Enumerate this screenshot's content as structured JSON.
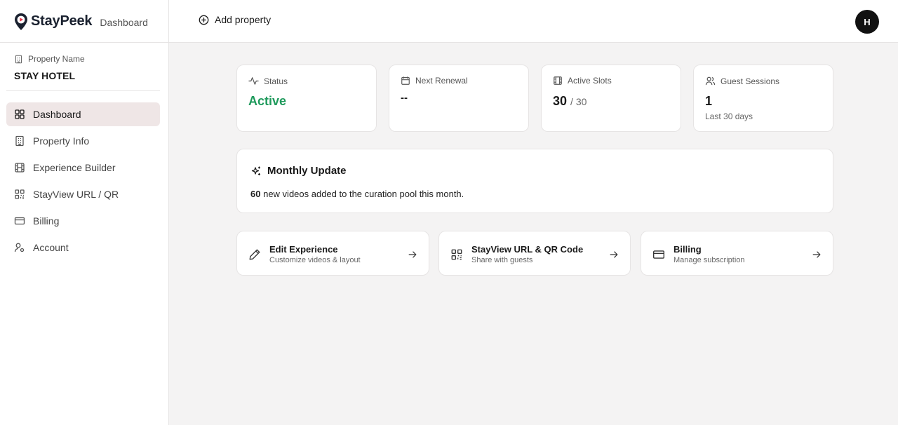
{
  "app": {
    "name": "StayPeek",
    "section": "Dashboard"
  },
  "header": {
    "add_property": "Add property",
    "avatar_initial": "H"
  },
  "sidebar": {
    "property_label": "Property Name",
    "property_name": "STAY HOTEL",
    "items": [
      {
        "label": "Dashboard",
        "icon": "grid-icon",
        "active": true
      },
      {
        "label": "Property Info",
        "icon": "building-icon"
      },
      {
        "label": "Experience Builder",
        "icon": "film-icon"
      },
      {
        "label": "StayView URL / QR",
        "icon": "qr-icon"
      },
      {
        "label": "Billing",
        "icon": "card-icon"
      },
      {
        "label": "Account",
        "icon": "user-settings-icon"
      }
    ]
  },
  "stats": {
    "status": {
      "label": "Status",
      "value": "Active"
    },
    "renewal": {
      "label": "Next Renewal",
      "value": "--"
    },
    "slots": {
      "label": "Active Slots",
      "value": "30",
      "total": "/ 30"
    },
    "sessions": {
      "label": "Guest Sessions",
      "value": "1",
      "sub": "Last 30 days"
    }
  },
  "monthly_update": {
    "title": "Monthly Update",
    "count": "60",
    "text": "new videos added to the curation pool this month."
  },
  "actions": [
    {
      "title": "Edit Experience",
      "sub": "Customize videos & layout"
    },
    {
      "title": "StayView URL & QR Code",
      "sub": "Share with guests"
    },
    {
      "title": "Billing",
      "sub": "Manage subscription"
    }
  ],
  "colors": {
    "accent_green": "#1f9a5c",
    "active_nav_bg": "#efe6e6",
    "brand_red": "#e8344a",
    "brand_dark": "#1b2230"
  }
}
